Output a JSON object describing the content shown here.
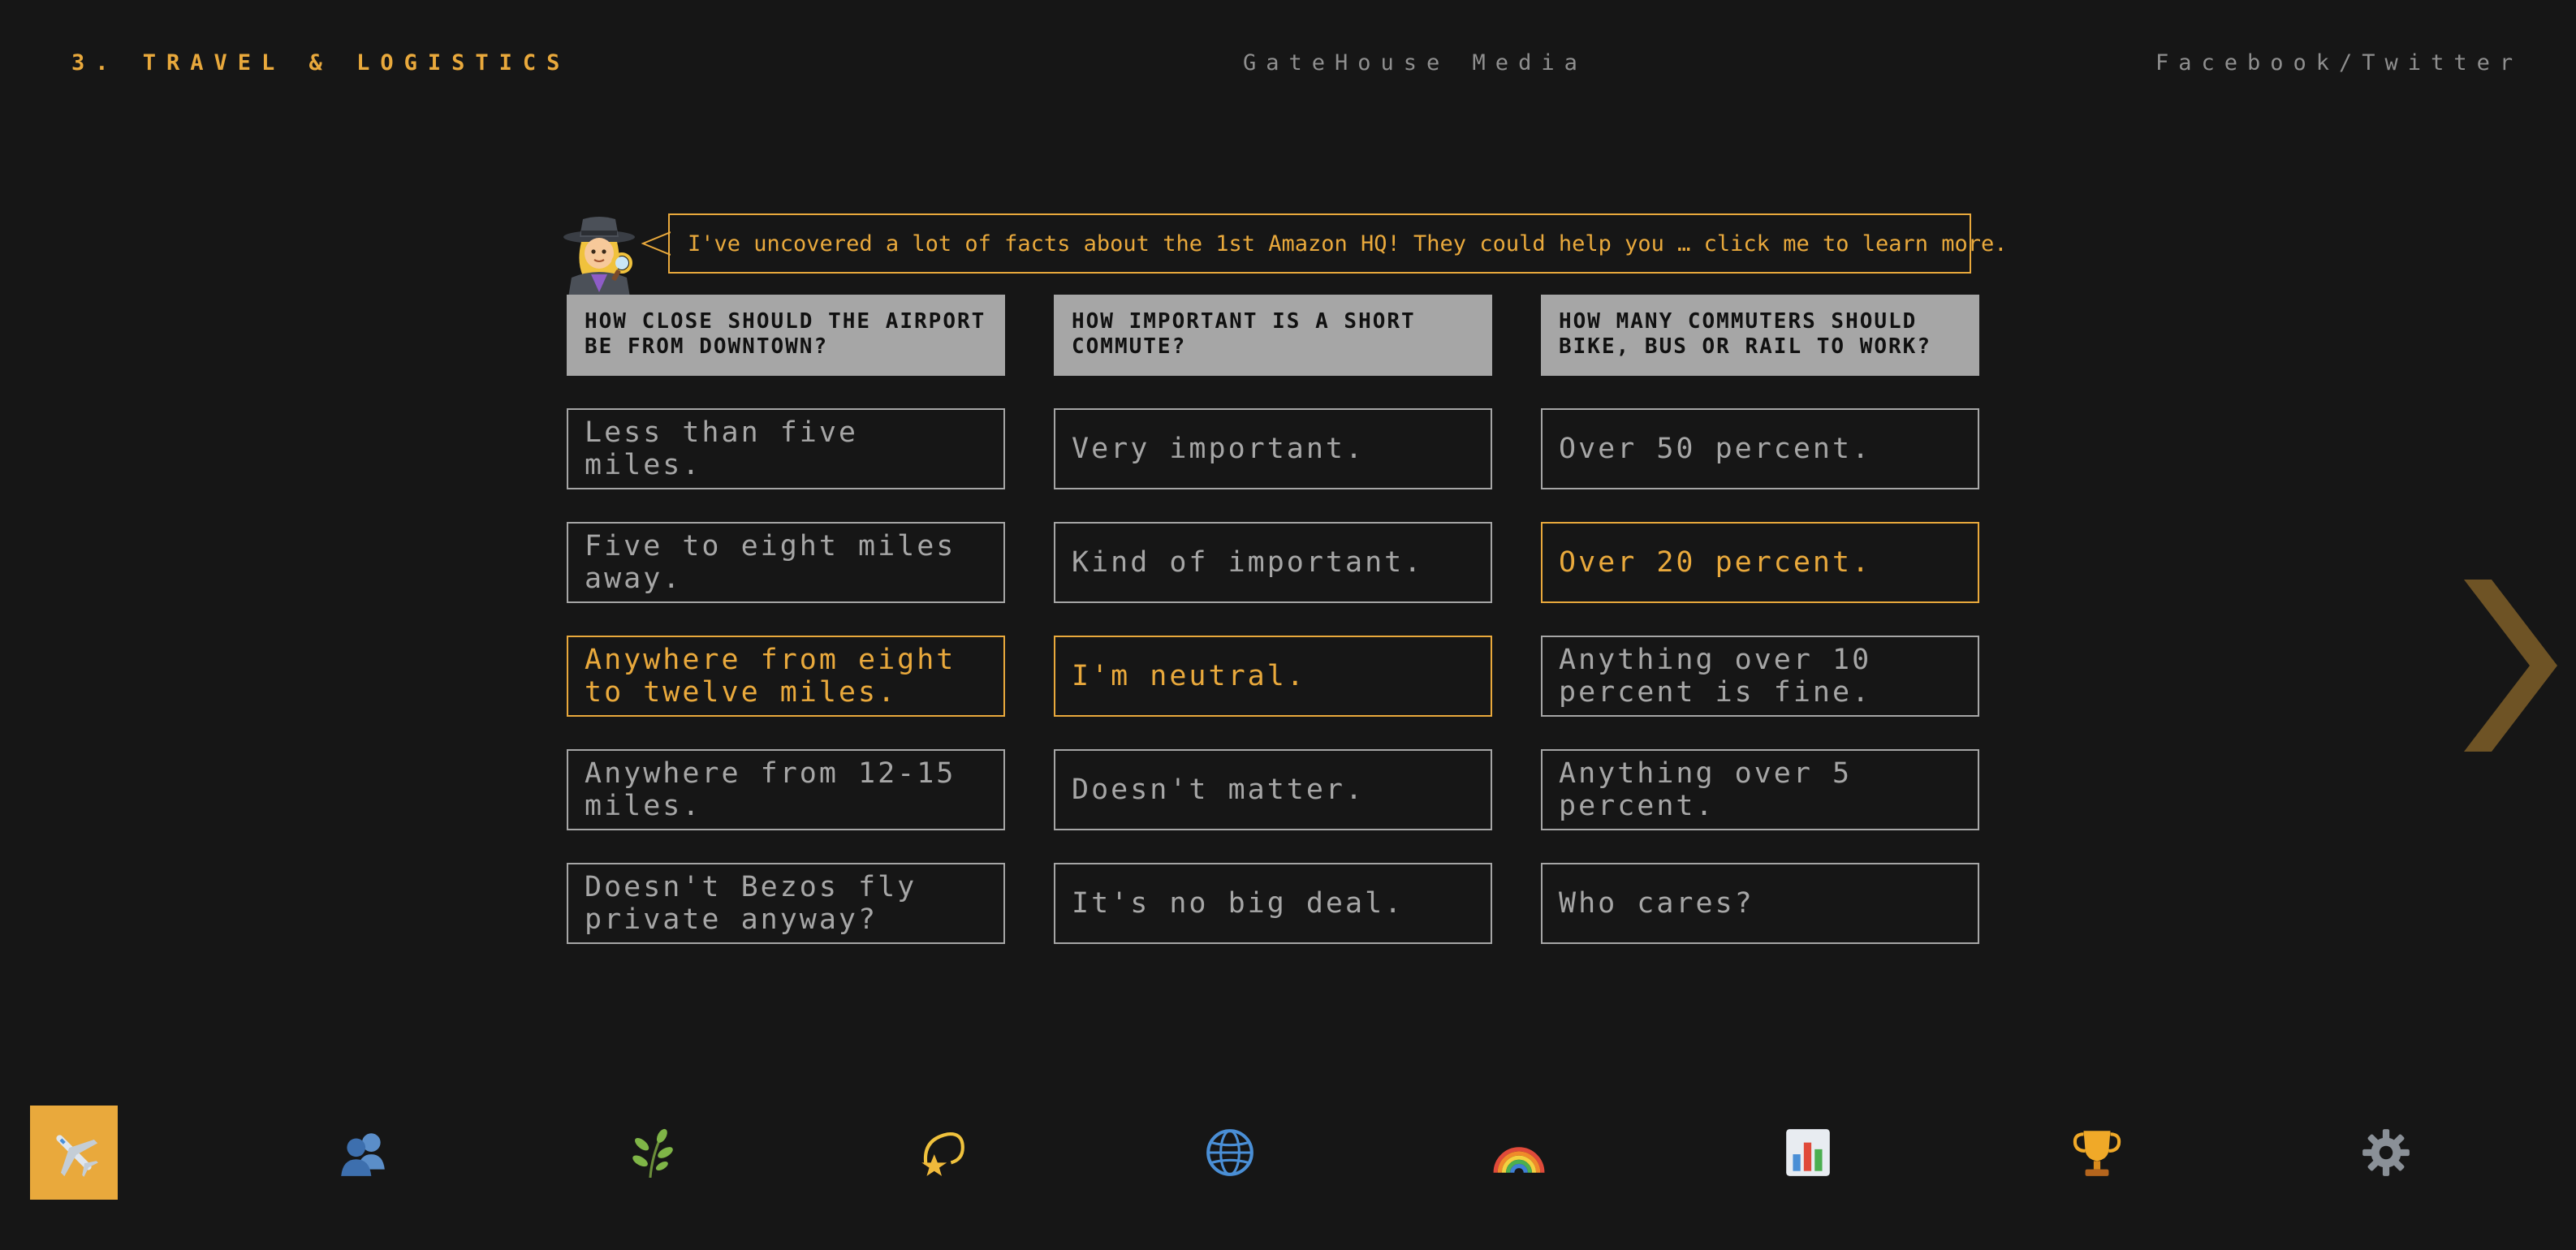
{
  "header": {
    "section_title": "3. TRAVEL & LOGISTICS",
    "brand": "GateHouse Media",
    "social": "Facebook/Twitter"
  },
  "detective": {
    "icon": "detective-woman-icon",
    "message": "I've uncovered a lot of facts about the 1st Amazon HQ! They could help you … click me to learn more."
  },
  "columns": [
    {
      "question": "HOW CLOSE SHOULD THE AIRPORT BE FROM DOWNTOWN?",
      "answers": [
        {
          "label": "Less than five miles.",
          "selected": false
        },
        {
          "label": "Five to eight miles away.",
          "selected": false
        },
        {
          "label": "Anywhere from eight to twelve miles.",
          "selected": true
        },
        {
          "label": "Anywhere from 12-15 miles.",
          "selected": false
        },
        {
          "label": "Doesn't Bezos fly private anyway?",
          "selected": false
        }
      ]
    },
    {
      "question": "HOW IMPORTANT IS A SHORT COMMUTE?",
      "answers": [
        {
          "label": "Very important.",
          "selected": false
        },
        {
          "label": "Kind of important.",
          "selected": false
        },
        {
          "label": "I'm neutral.",
          "selected": true
        },
        {
          "label": "Doesn't matter.",
          "selected": false
        },
        {
          "label": "It's no big deal.",
          "selected": false
        }
      ]
    },
    {
      "question": "HOW MANY COMMUTERS SHOULD BIKE, BUS OR RAIL TO WORK?",
      "answers": [
        {
          "label": "Over 50 percent.",
          "selected": false
        },
        {
          "label": "Over 20 percent.",
          "selected": true
        },
        {
          "label": "Anything over 10 percent is fine.",
          "selected": false
        },
        {
          "label": "Anything over 5 percent.",
          "selected": false
        },
        {
          "label": "Who cares?",
          "selected": false
        }
      ]
    }
  ],
  "navigation": {
    "next_icon": "chevron-right-icon",
    "items": [
      {
        "icon": "airplane-icon",
        "active": true
      },
      {
        "icon": "people-icon",
        "active": false
      },
      {
        "icon": "herb-icon",
        "active": false
      },
      {
        "icon": "shooting-star-icon",
        "active": false
      },
      {
        "icon": "globe-icon",
        "active": false
      },
      {
        "icon": "rainbow-icon",
        "active": false
      },
      {
        "icon": "bar-chart-icon",
        "active": false
      },
      {
        "icon": "trophy-icon",
        "active": false
      },
      {
        "icon": "gear-icon",
        "active": false
      }
    ]
  },
  "colors": {
    "background": "#161616",
    "accent": "#e9a93c",
    "muted": "#a6a6a6"
  }
}
